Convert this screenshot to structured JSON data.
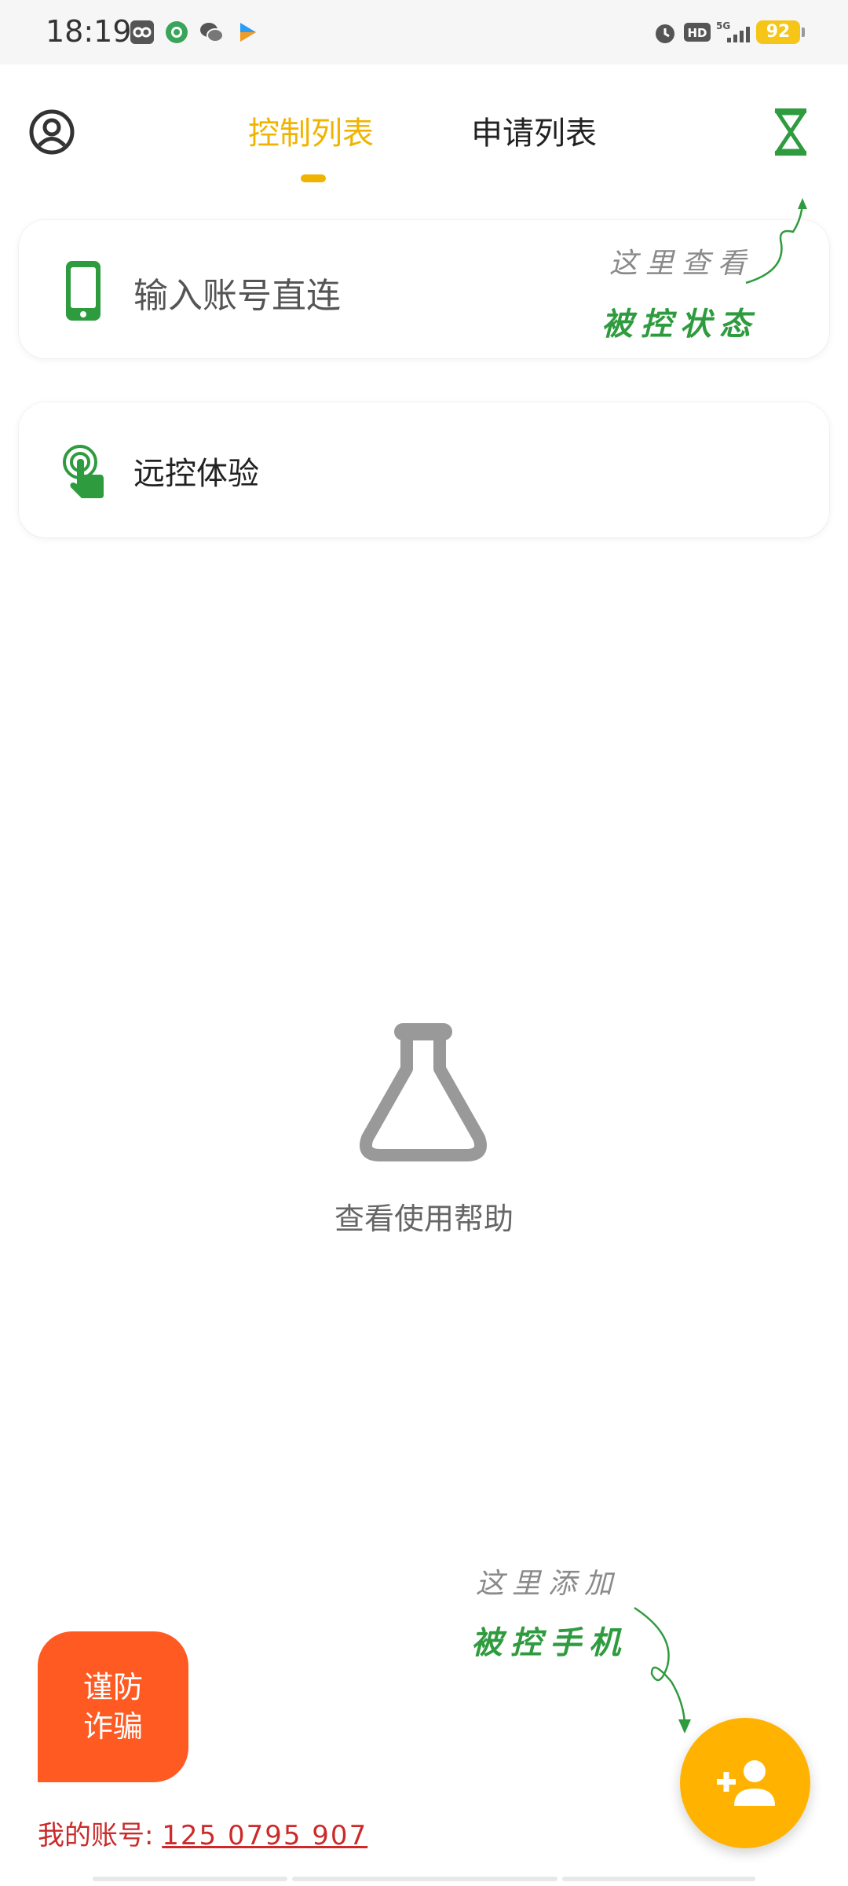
{
  "status_bar": {
    "time": "18:19",
    "battery": "92"
  },
  "header": {
    "tabs": [
      {
        "label": "控制列表",
        "active": true
      },
      {
        "label": "申请列表",
        "active": false
      }
    ]
  },
  "cards": {
    "direct_connect": {
      "label": "输入账号直连"
    },
    "remote_trial": {
      "label": "远控体验"
    }
  },
  "hints": {
    "status_line1": "这里查看",
    "status_line2": "被控状态",
    "add_line1": "这里添加",
    "add_line2": "被控手机"
  },
  "center": {
    "help_text": "查看使用帮助"
  },
  "fraud": {
    "line1": "谨防",
    "line2": "诈骗"
  },
  "account": {
    "label": "我的账号: ",
    "number": "125 0795 907"
  },
  "colors": {
    "accent_yellow": "#f0b400",
    "green": "#2f9b3f",
    "fraud_orange": "#ff5a22",
    "fab": "#ffb300"
  }
}
